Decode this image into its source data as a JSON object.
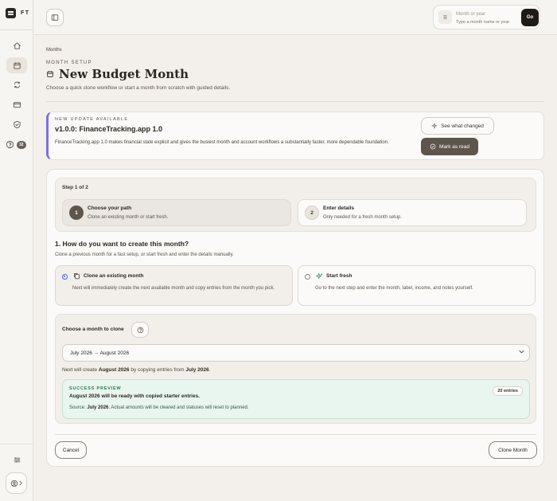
{
  "app": {
    "logo_text": "FT"
  },
  "sidebar": {
    "icons": [
      "home-icon",
      "calendar-icon",
      "refresh-icon",
      "card-icon",
      "shield-icon",
      "help-icon"
    ],
    "help_badge": "32"
  },
  "search": {
    "label": "Month or year",
    "hint": "Type a month name or year",
    "go_label": "Go"
  },
  "page": {
    "breadcrumb": "Months",
    "eyebrow": "MONTH SETUP",
    "title": "New Budget Month",
    "subtitle": "Choose a quick clone workflow or start a month from scratch with guided details."
  },
  "update": {
    "eyebrow": "NEW UPDATE AVAILABLE",
    "title": "v1.0.0: FinanceTracking.app 1.0",
    "text": "FinanceTracking.app 1.0 makes financial state explicit and gives the busiest month and account workflows a substantially faster, more dependable foundation.",
    "see_changed": "See what changed",
    "mark_read": "Mark as read"
  },
  "steps": {
    "label": "Step 1 of 2",
    "items": [
      {
        "num": "1",
        "title": "Choose your path",
        "sub": "Clone an existing month or start fresh."
      },
      {
        "num": "2",
        "title": "Enter details",
        "sub": "Only needed for a fresh month setup."
      }
    ]
  },
  "question": {
    "title": "1. How do you want to create this month?",
    "sub": "Clone a previous month for a fast setup, or start fresh and enter the details manually."
  },
  "options": [
    {
      "title": "Clone an existing month",
      "desc": "Next will immediately create the next available month and copy entries from the month you pick.",
      "selected": true
    },
    {
      "title": "Start fresh",
      "desc": "Go to the next step and enter the month, label, income, and notes yourself.",
      "selected": false
    }
  ],
  "clone": {
    "label": "Choose a month to clone",
    "selected": "July 2026 → August 2026",
    "note_prefix": "Next will create ",
    "note_target": "August 2026",
    "note_mid": " by copying entries from ",
    "note_source": "July 2026",
    "note_end": ".",
    "success": {
      "eyebrow": "SUCCESS PREVIEW",
      "title": "August 2026 will be ready with copied starter entries.",
      "desc_prefix": "Source: ",
      "desc_source": "July 2026",
      "desc_rest": ". Actual amounts will be cleared and statuses will reset to planned.",
      "badge": "20 entries"
    }
  },
  "footer": {
    "cancel": "Cancel",
    "submit": "Clone Month"
  },
  "colors": {
    "accent": "#7a6fe0",
    "primary": "#5e554c",
    "success_bg": "#e8f6ef",
    "radio": "#3b5bd9"
  }
}
